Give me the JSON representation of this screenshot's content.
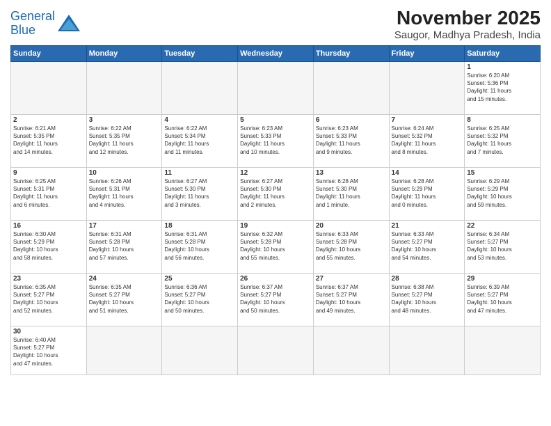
{
  "header": {
    "logo_line1": "General",
    "logo_line2": "Blue",
    "month": "November 2025",
    "location": "Saugor, Madhya Pradesh, India"
  },
  "weekdays": [
    "Sunday",
    "Monday",
    "Tuesday",
    "Wednesday",
    "Thursday",
    "Friday",
    "Saturday"
  ],
  "weeks": [
    [
      {
        "day": "",
        "info": ""
      },
      {
        "day": "",
        "info": ""
      },
      {
        "day": "",
        "info": ""
      },
      {
        "day": "",
        "info": ""
      },
      {
        "day": "",
        "info": ""
      },
      {
        "day": "",
        "info": ""
      },
      {
        "day": "1",
        "info": "Sunrise: 6:20 AM\nSunset: 5:36 PM\nDaylight: 11 hours\nand 15 minutes."
      }
    ],
    [
      {
        "day": "2",
        "info": "Sunrise: 6:21 AM\nSunset: 5:35 PM\nDaylight: 11 hours\nand 14 minutes."
      },
      {
        "day": "3",
        "info": "Sunrise: 6:22 AM\nSunset: 5:35 PM\nDaylight: 11 hours\nand 12 minutes."
      },
      {
        "day": "4",
        "info": "Sunrise: 6:22 AM\nSunset: 5:34 PM\nDaylight: 11 hours\nand 11 minutes."
      },
      {
        "day": "5",
        "info": "Sunrise: 6:23 AM\nSunset: 5:33 PM\nDaylight: 11 hours\nand 10 minutes."
      },
      {
        "day": "6",
        "info": "Sunrise: 6:23 AM\nSunset: 5:33 PM\nDaylight: 11 hours\nand 9 minutes."
      },
      {
        "day": "7",
        "info": "Sunrise: 6:24 AM\nSunset: 5:32 PM\nDaylight: 11 hours\nand 8 minutes."
      },
      {
        "day": "8",
        "info": "Sunrise: 6:25 AM\nSunset: 5:32 PM\nDaylight: 11 hours\nand 7 minutes."
      }
    ],
    [
      {
        "day": "9",
        "info": "Sunrise: 6:25 AM\nSunset: 5:31 PM\nDaylight: 11 hours\nand 6 minutes."
      },
      {
        "day": "10",
        "info": "Sunrise: 6:26 AM\nSunset: 5:31 PM\nDaylight: 11 hours\nand 4 minutes."
      },
      {
        "day": "11",
        "info": "Sunrise: 6:27 AM\nSunset: 5:30 PM\nDaylight: 11 hours\nand 3 minutes."
      },
      {
        "day": "12",
        "info": "Sunrise: 6:27 AM\nSunset: 5:30 PM\nDaylight: 11 hours\nand 2 minutes."
      },
      {
        "day": "13",
        "info": "Sunrise: 6:28 AM\nSunset: 5:30 PM\nDaylight: 11 hours\nand 1 minute."
      },
      {
        "day": "14",
        "info": "Sunrise: 6:28 AM\nSunset: 5:29 PM\nDaylight: 11 hours\nand 0 minutes."
      },
      {
        "day": "15",
        "info": "Sunrise: 6:29 AM\nSunset: 5:29 PM\nDaylight: 10 hours\nand 59 minutes."
      }
    ],
    [
      {
        "day": "16",
        "info": "Sunrise: 6:30 AM\nSunset: 5:29 PM\nDaylight: 10 hours\nand 58 minutes."
      },
      {
        "day": "17",
        "info": "Sunrise: 6:31 AM\nSunset: 5:28 PM\nDaylight: 10 hours\nand 57 minutes."
      },
      {
        "day": "18",
        "info": "Sunrise: 6:31 AM\nSunset: 5:28 PM\nDaylight: 10 hours\nand 56 minutes."
      },
      {
        "day": "19",
        "info": "Sunrise: 6:32 AM\nSunset: 5:28 PM\nDaylight: 10 hours\nand 55 minutes."
      },
      {
        "day": "20",
        "info": "Sunrise: 6:33 AM\nSunset: 5:28 PM\nDaylight: 10 hours\nand 55 minutes."
      },
      {
        "day": "21",
        "info": "Sunrise: 6:33 AM\nSunset: 5:27 PM\nDaylight: 10 hours\nand 54 minutes."
      },
      {
        "day": "22",
        "info": "Sunrise: 6:34 AM\nSunset: 5:27 PM\nDaylight: 10 hours\nand 53 minutes."
      }
    ],
    [
      {
        "day": "23",
        "info": "Sunrise: 6:35 AM\nSunset: 5:27 PM\nDaylight: 10 hours\nand 52 minutes."
      },
      {
        "day": "24",
        "info": "Sunrise: 6:35 AM\nSunset: 5:27 PM\nDaylight: 10 hours\nand 51 minutes."
      },
      {
        "day": "25",
        "info": "Sunrise: 6:36 AM\nSunset: 5:27 PM\nDaylight: 10 hours\nand 50 minutes."
      },
      {
        "day": "26",
        "info": "Sunrise: 6:37 AM\nSunset: 5:27 PM\nDaylight: 10 hours\nand 50 minutes."
      },
      {
        "day": "27",
        "info": "Sunrise: 6:37 AM\nSunset: 5:27 PM\nDaylight: 10 hours\nand 49 minutes."
      },
      {
        "day": "28",
        "info": "Sunrise: 6:38 AM\nSunset: 5:27 PM\nDaylight: 10 hours\nand 48 minutes."
      },
      {
        "day": "29",
        "info": "Sunrise: 6:39 AM\nSunset: 5:27 PM\nDaylight: 10 hours\nand 47 minutes."
      }
    ],
    [
      {
        "day": "30",
        "info": "Sunrise: 6:40 AM\nSunset: 5:27 PM\nDaylight: 10 hours\nand 47 minutes."
      },
      {
        "day": "",
        "info": ""
      },
      {
        "day": "",
        "info": ""
      },
      {
        "day": "",
        "info": ""
      },
      {
        "day": "",
        "info": ""
      },
      {
        "day": "",
        "info": ""
      },
      {
        "day": "",
        "info": ""
      }
    ]
  ]
}
